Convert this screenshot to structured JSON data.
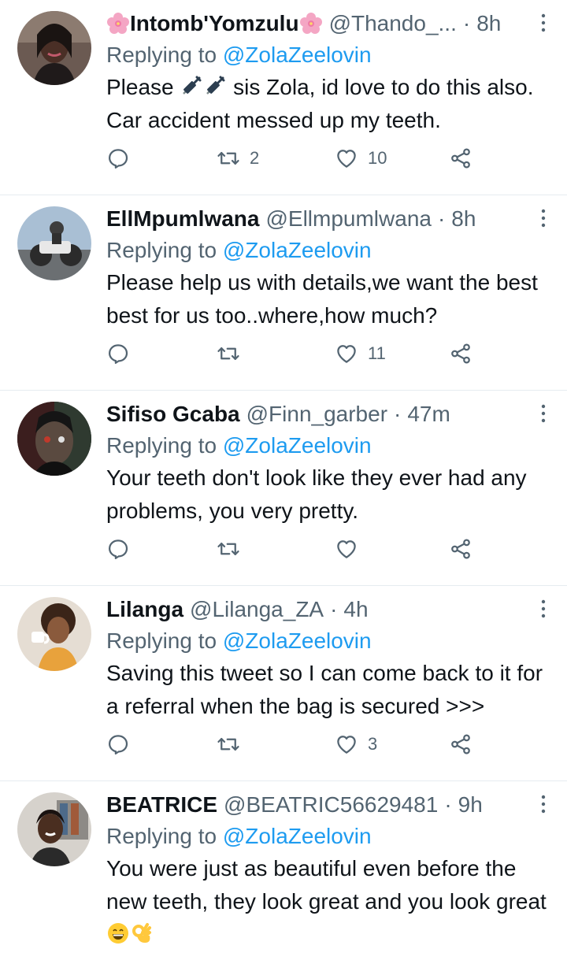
{
  "tweets": [
    {
      "display_name": "Intomb'Yomzulu",
      "handle": "@Thando_...",
      "time": "8h",
      "replying_label": "Replying to",
      "replying_to": "@ZolaZeelovin",
      "text_before": "Please",
      "text_after": " sis Zola, id love to do this also. Car accident messed up my teeth.",
      "retweets": "2",
      "likes": "10",
      "avatar_color": "#3a2a26"
    },
    {
      "display_name": "EllMpumlwana",
      "handle": "@Ellmpumlwana",
      "time": "8h",
      "replying_label": "Replying to",
      "replying_to": "@ZolaZeelovin",
      "text": "Please help us with details,we want the best best for us too..where,how much?",
      "retweets": "",
      "likes": "11",
      "avatar_color": "#8fa6bd"
    },
    {
      "display_name": "Sifiso Gcaba",
      "handle": "@Finn_garber",
      "time": "47m",
      "replying_label": "Replying to",
      "replying_to": "@ZolaZeelovin",
      "text": "Your teeth don't look like they ever had any problems, you very pretty.",
      "retweets": "",
      "likes": "",
      "avatar_color": "#2a2f2a"
    },
    {
      "display_name": "Lilanga",
      "handle": "@Lilanga_ZA",
      "time": "4h",
      "replying_label": "Replying to",
      "replying_to": "@ZolaZeelovin",
      "text": "Saving this tweet so I can come back to it for a referral when the bag is secured >>>",
      "retweets": "",
      "likes": "3",
      "avatar_color": "#d9cfc2"
    },
    {
      "display_name": "BEATRICE",
      "handle": "@BEATRIC56629481",
      "time": "9h",
      "replying_label": "Replying to",
      "replying_to": "@ZolaZeelovin",
      "text_before": "You were just as beautiful even before the new teeth, they look great and you look great",
      "avatar_color": "#c9c4bd"
    }
  ],
  "colors": {
    "text": "#0f1419",
    "secondary": "#536471",
    "link": "#1d9bf0",
    "divider": "#e6ecf0"
  },
  "icons": {
    "reply": "reply-icon",
    "retweet": "retweet-icon",
    "like": "heart-icon",
    "share": "share-icon",
    "more": "more-icon",
    "flower": "cherry-blossom-emoji",
    "syringe": "syringe-emoji",
    "grin": "grinning-face-emoji",
    "ok": "ok-hand-emoji"
  }
}
